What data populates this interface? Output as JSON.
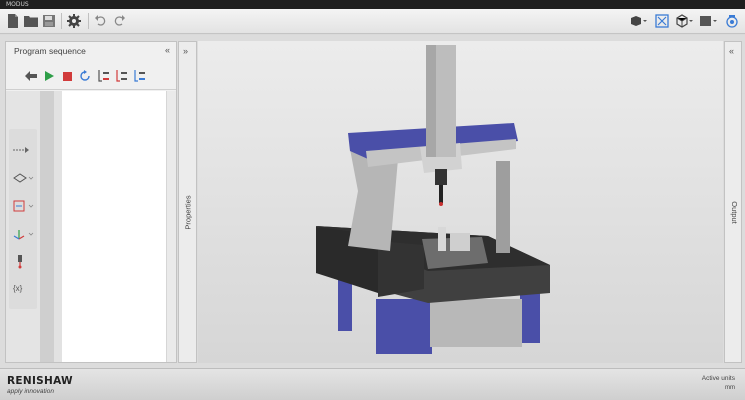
{
  "window": {
    "title": "MODUS"
  },
  "toolbar": {
    "left_icons": [
      "new-file-icon",
      "open-folder-icon",
      "save-icon",
      "settings-gear-icon",
      "undo-icon",
      "redo-icon"
    ],
    "right_icons": [
      "render-mode-icon",
      "zoom-fit-icon",
      "view-cube-icon",
      "display-mode-icon",
      "camera-icon"
    ]
  },
  "left_panel": {
    "title": "Program sequence",
    "collapse_glyph": "«",
    "tools": [
      "back-arrow-icon",
      "run-play-icon",
      "stop-icon",
      "refresh-icon",
      "step-indent-icon",
      "step-outdent-icon",
      "step-list-icon"
    ],
    "palette": [
      "move-icon",
      "feature-icon",
      "measure-icon",
      "axis-icon",
      "probe-icon",
      "variable-icon"
    ],
    "palette_labels": {
      "variable": "{x}"
    }
  },
  "properties_strip": {
    "label": "Properties",
    "chevron": "»"
  },
  "output_strip": {
    "label": "Output",
    "chevron": "«"
  },
  "status": {
    "logo": "RENISHAW",
    "tagline": "apply innovation",
    "active_units_label": "Active units",
    "active_units_value": "mm"
  },
  "colors": {
    "accent_blue": "#4a4fa8",
    "machine_dark": "#303030",
    "machine_gray": "#b4b4b4",
    "play_green": "#2e9e48",
    "stop_red": "#d13b3b"
  }
}
